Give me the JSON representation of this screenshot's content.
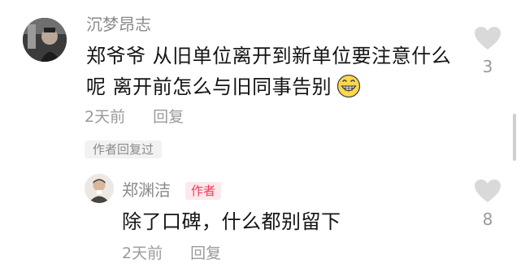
{
  "comment": {
    "username": "沉梦昂志",
    "text": "郑爷爷 从旧单位离开到新单位要注意什么呢 离开前怎么与旧同事告别",
    "emoji": "grinning-face-emoji",
    "time": "2天前",
    "reply_label": "回复",
    "author_replied_label": "作者回复过",
    "likes": "3"
  },
  "reply": {
    "username": "郑渊洁",
    "author_badge": "作者",
    "text": "除了口碑，什么都别留下",
    "time": "2天前",
    "reply_label": "回复",
    "likes": "8"
  },
  "icons": {
    "like": "heart-icon"
  },
  "colors": {
    "username": "#8a8a8a",
    "text": "#141414",
    "meta": "#9a9a9a",
    "heart": "#d9d9d9",
    "author_badge_bg": "#fde8eb",
    "author_badge_text": "#f2395b",
    "tag_bg": "#f2f2f2"
  }
}
